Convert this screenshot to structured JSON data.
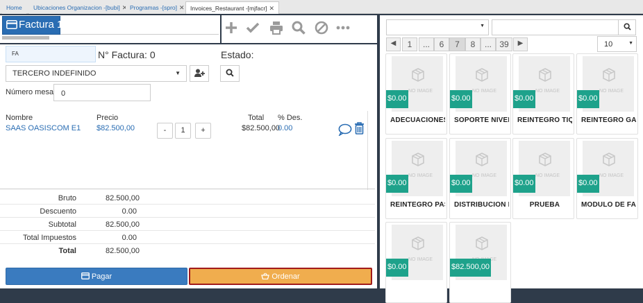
{
  "tabs": [
    {
      "label": "Home",
      "closable": false
    },
    {
      "label": "Ubicaciones Organizacion -[bubi]",
      "closable": true
    },
    {
      "label": "Programas -[spro]",
      "closable": true
    },
    {
      "label": "Invoices_Restaurant -[mjfacr]",
      "closable": true
    }
  ],
  "header": {
    "factura_label": "Factura 1",
    "toolbar_icons": [
      "plus-icon",
      "check-icon",
      "print-icon",
      "search-icon",
      "cancel-icon",
      "more-icon"
    ]
  },
  "form": {
    "fa_value": "FA",
    "nfactura_label": "N° Factura: 0",
    "estado_label": "Estado:",
    "tercero_value": "TERCERO INDEFINIDO",
    "mesa_label": "Número mesa:",
    "mesa_value": "0"
  },
  "items": {
    "headers": {
      "nombre": "Nombre",
      "precio": "Precio",
      "total": "Total",
      "descuento": "% Des."
    },
    "rows": [
      {
        "nombre": "SAAS OASISCOM E1",
        "precio": "$82.500,00",
        "cantidad": "1",
        "minus": "-",
        "plus": "+",
        "total": "$82.500,00",
        "descuento": "0.00"
      }
    ]
  },
  "totals": [
    {
      "label": "Bruto",
      "value": "82.500,00",
      "bold": false
    },
    {
      "label": "Descuento",
      "value": "0.00",
      "bold": false
    },
    {
      "label": "Subtotal",
      "value": "82.500,00",
      "bold": false
    },
    {
      "label": "Total Impuestos",
      "value": "0.00",
      "bold": false
    },
    {
      "label": "Total",
      "value": "82.500,00",
      "bold": true
    }
  ],
  "actions": {
    "pagar": "Pagar",
    "ordenar": "Ordenar"
  },
  "catalog": {
    "filter1_value": "",
    "filter2_value": "",
    "pagination": {
      "prev": "◀",
      "next": "▶",
      "pages": [
        "1",
        "...",
        "6",
        "7",
        "8",
        "...",
        "39"
      ],
      "current": "7"
    },
    "page_size": "10",
    "products": [
      {
        "name": "ADECUACIONES",
        "price": "$0.00"
      },
      {
        "name": "SOPORTE NIVEL",
        "price": "$0.00"
      },
      {
        "name": "REINTEGRO TIQ",
        "price": "$0.00"
      },
      {
        "name": "REINTEGRO GA",
        "price": "$0.00"
      },
      {
        "name": "REINTEGRO PAS",
        "price": "$0.00"
      },
      {
        "name": "DISTRIBUCION F",
        "price": "$0.00"
      },
      {
        "name": "PRUEBA",
        "price": "$0.00"
      },
      {
        "name": "MODULO DE FA",
        "price": "$0.00"
      },
      {
        "name": "",
        "price": "$0.00"
      },
      {
        "name": "",
        "price": "$82.500,00"
      }
    ],
    "no_image_text": "NO IMAGE"
  },
  "colors": {
    "primary": "#2a6db3",
    "warning": "#f0ad4e",
    "price_badge": "#1ea28b",
    "ordenar_border": "#a01a1a"
  }
}
